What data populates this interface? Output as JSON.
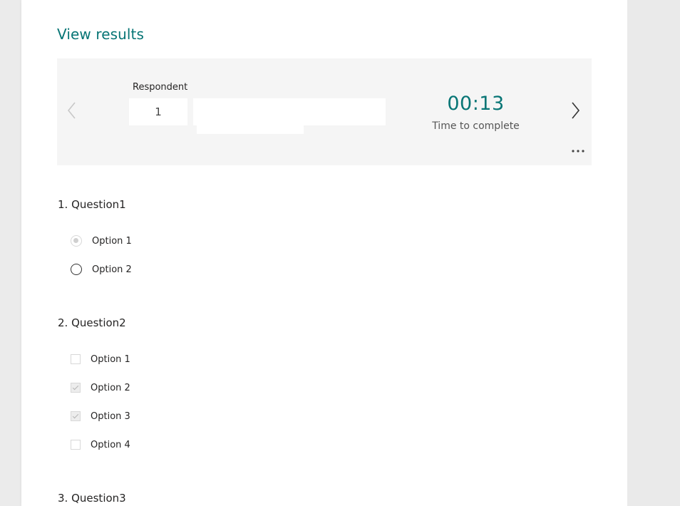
{
  "page": {
    "title": "View results"
  },
  "respondent": {
    "label": "Respondent",
    "number": "1",
    "time_value": "00:13",
    "time_label": "Time to complete"
  },
  "questions": [
    {
      "title": "1. Question1",
      "type": "radio",
      "options": [
        {
          "label": "Option 1",
          "selected": true
        },
        {
          "label": "Option 2",
          "selected": false
        }
      ]
    },
    {
      "title": "2. Question2",
      "type": "checkbox",
      "options": [
        {
          "label": "Option 1",
          "selected": false
        },
        {
          "label": "Option 2",
          "selected": true
        },
        {
          "label": "Option 3",
          "selected": true
        },
        {
          "label": "Option 4",
          "selected": false
        }
      ]
    },
    {
      "title": "3. Question3"
    }
  ],
  "colors": {
    "accent": "#077575",
    "panel": "#f5f5f5",
    "background": "#ebebeb"
  },
  "icons": {
    "prev": "chevron-left-icon",
    "next": "chevron-right-icon",
    "more": "more-horizontal-icon"
  }
}
